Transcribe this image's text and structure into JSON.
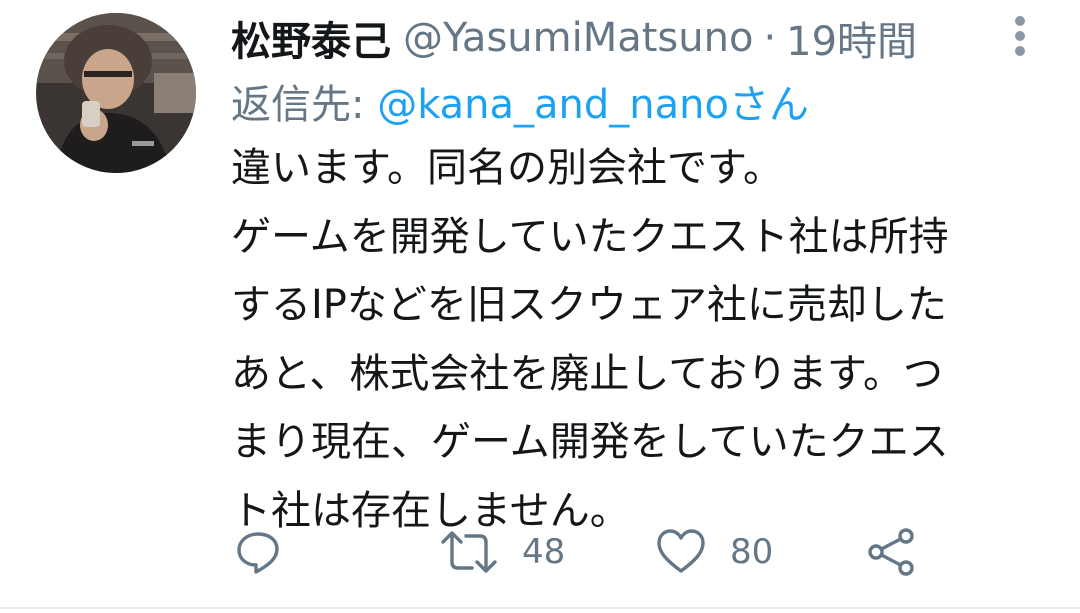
{
  "tweet": {
    "display_name": "松野泰己",
    "handle": "@YasumiMatsuno",
    "separator": "·",
    "time": "19時間",
    "reply_prefix": "返信先: ",
    "reply_mention": "@kana_and_nano",
    "reply_suffix": "さん",
    "body_lines": [
      "違います。同名の別会社です。",
      "ゲームを開発していたクエスト社は所持",
      "するIPなどを旧スクウェア社に売却した",
      "あと、株式会社を廃止しております。つ",
      "まり現在、ゲーム開発をしていたクエス",
      "ト社は存在しません。"
    ],
    "retweet_count": "48",
    "like_count": "80"
  },
  "icons": {
    "reply": "reply-icon",
    "retweet": "retweet-icon",
    "like": "heart-icon",
    "share": "share-icon",
    "more": "more-vertical-icon"
  },
  "colors": {
    "text": "#14171a",
    "secondary": "#657786",
    "link": "#1da1f2",
    "icon": "#657786"
  }
}
